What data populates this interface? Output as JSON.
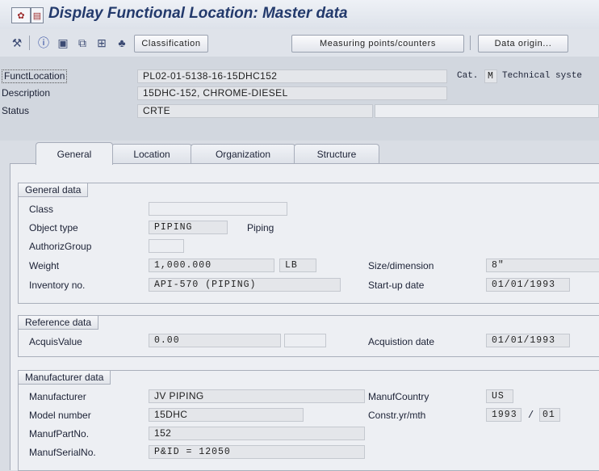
{
  "window": {
    "title": "Display Functional Location: Master data",
    "title_icons": [
      "sap-logo-icon",
      "window-menu-icon"
    ]
  },
  "toolbar": {
    "icons": [
      "settings-wrench-icon",
      "info-icon",
      "document-icon",
      "hierarchy-icon",
      "structure-list-icon",
      "tree-structure-icon"
    ],
    "classification_label": "Classification",
    "measuring_points_label": "Measuring points/counters",
    "data_origin_label": "Data origin..."
  },
  "header": {
    "funcloc_label": "FunctLocation",
    "funcloc_value": "PL02-01-5138-16-15DHC152",
    "cat_label": "Cat.",
    "cat_value": "M",
    "cat_text": "Technical syste",
    "description_label": "Description",
    "description_value": "15DHC-152, CHROME-DIESEL",
    "status_label": "Status",
    "status_value": "CRTE"
  },
  "tabs": [
    {
      "label": "General"
    },
    {
      "label": "Location"
    },
    {
      "label": "Organization"
    },
    {
      "label": "Structure"
    }
  ],
  "general_data": {
    "title": "General data",
    "class_label": "Class",
    "class_value": "",
    "object_type_label": "Object type",
    "object_type_value": "PIPING",
    "object_type_text": "Piping",
    "authgroup_label": "AuthorizGroup",
    "authgroup_value": "",
    "weight_label": "Weight",
    "weight_value": "1,000.000",
    "weight_unit": "LB",
    "size_label": "Size/dimension",
    "size_value": "8\"",
    "inventory_label": "Inventory no.",
    "inventory_value": "API-570 (PIPING)",
    "startup_label": "Start-up date",
    "startup_value": "01/01/1993"
  },
  "reference_data": {
    "title": "Reference data",
    "acquis_label": "AcquisValue",
    "acquis_value": "0.00",
    "acquis_currency": "",
    "acq_date_label": "Acquistion date",
    "acq_date_value": "01/01/1993"
  },
  "manufacturer_data": {
    "title": "Manufacturer data",
    "manufacturer_label": "Manufacturer",
    "manufacturer_value": "JV PIPING",
    "country_label": "ManufCountry",
    "country_value": "US",
    "model_label": "Model number",
    "model_value": "15DHC",
    "constr_label": "Constr.yr/mth",
    "constr_year": "1993",
    "constr_sep": "/",
    "constr_month": "01",
    "partno_label": "ManufPartNo.",
    "partno_value": "152",
    "serial_label": "ManufSerialNo.",
    "serial_value": "P&ID = 12050"
  }
}
